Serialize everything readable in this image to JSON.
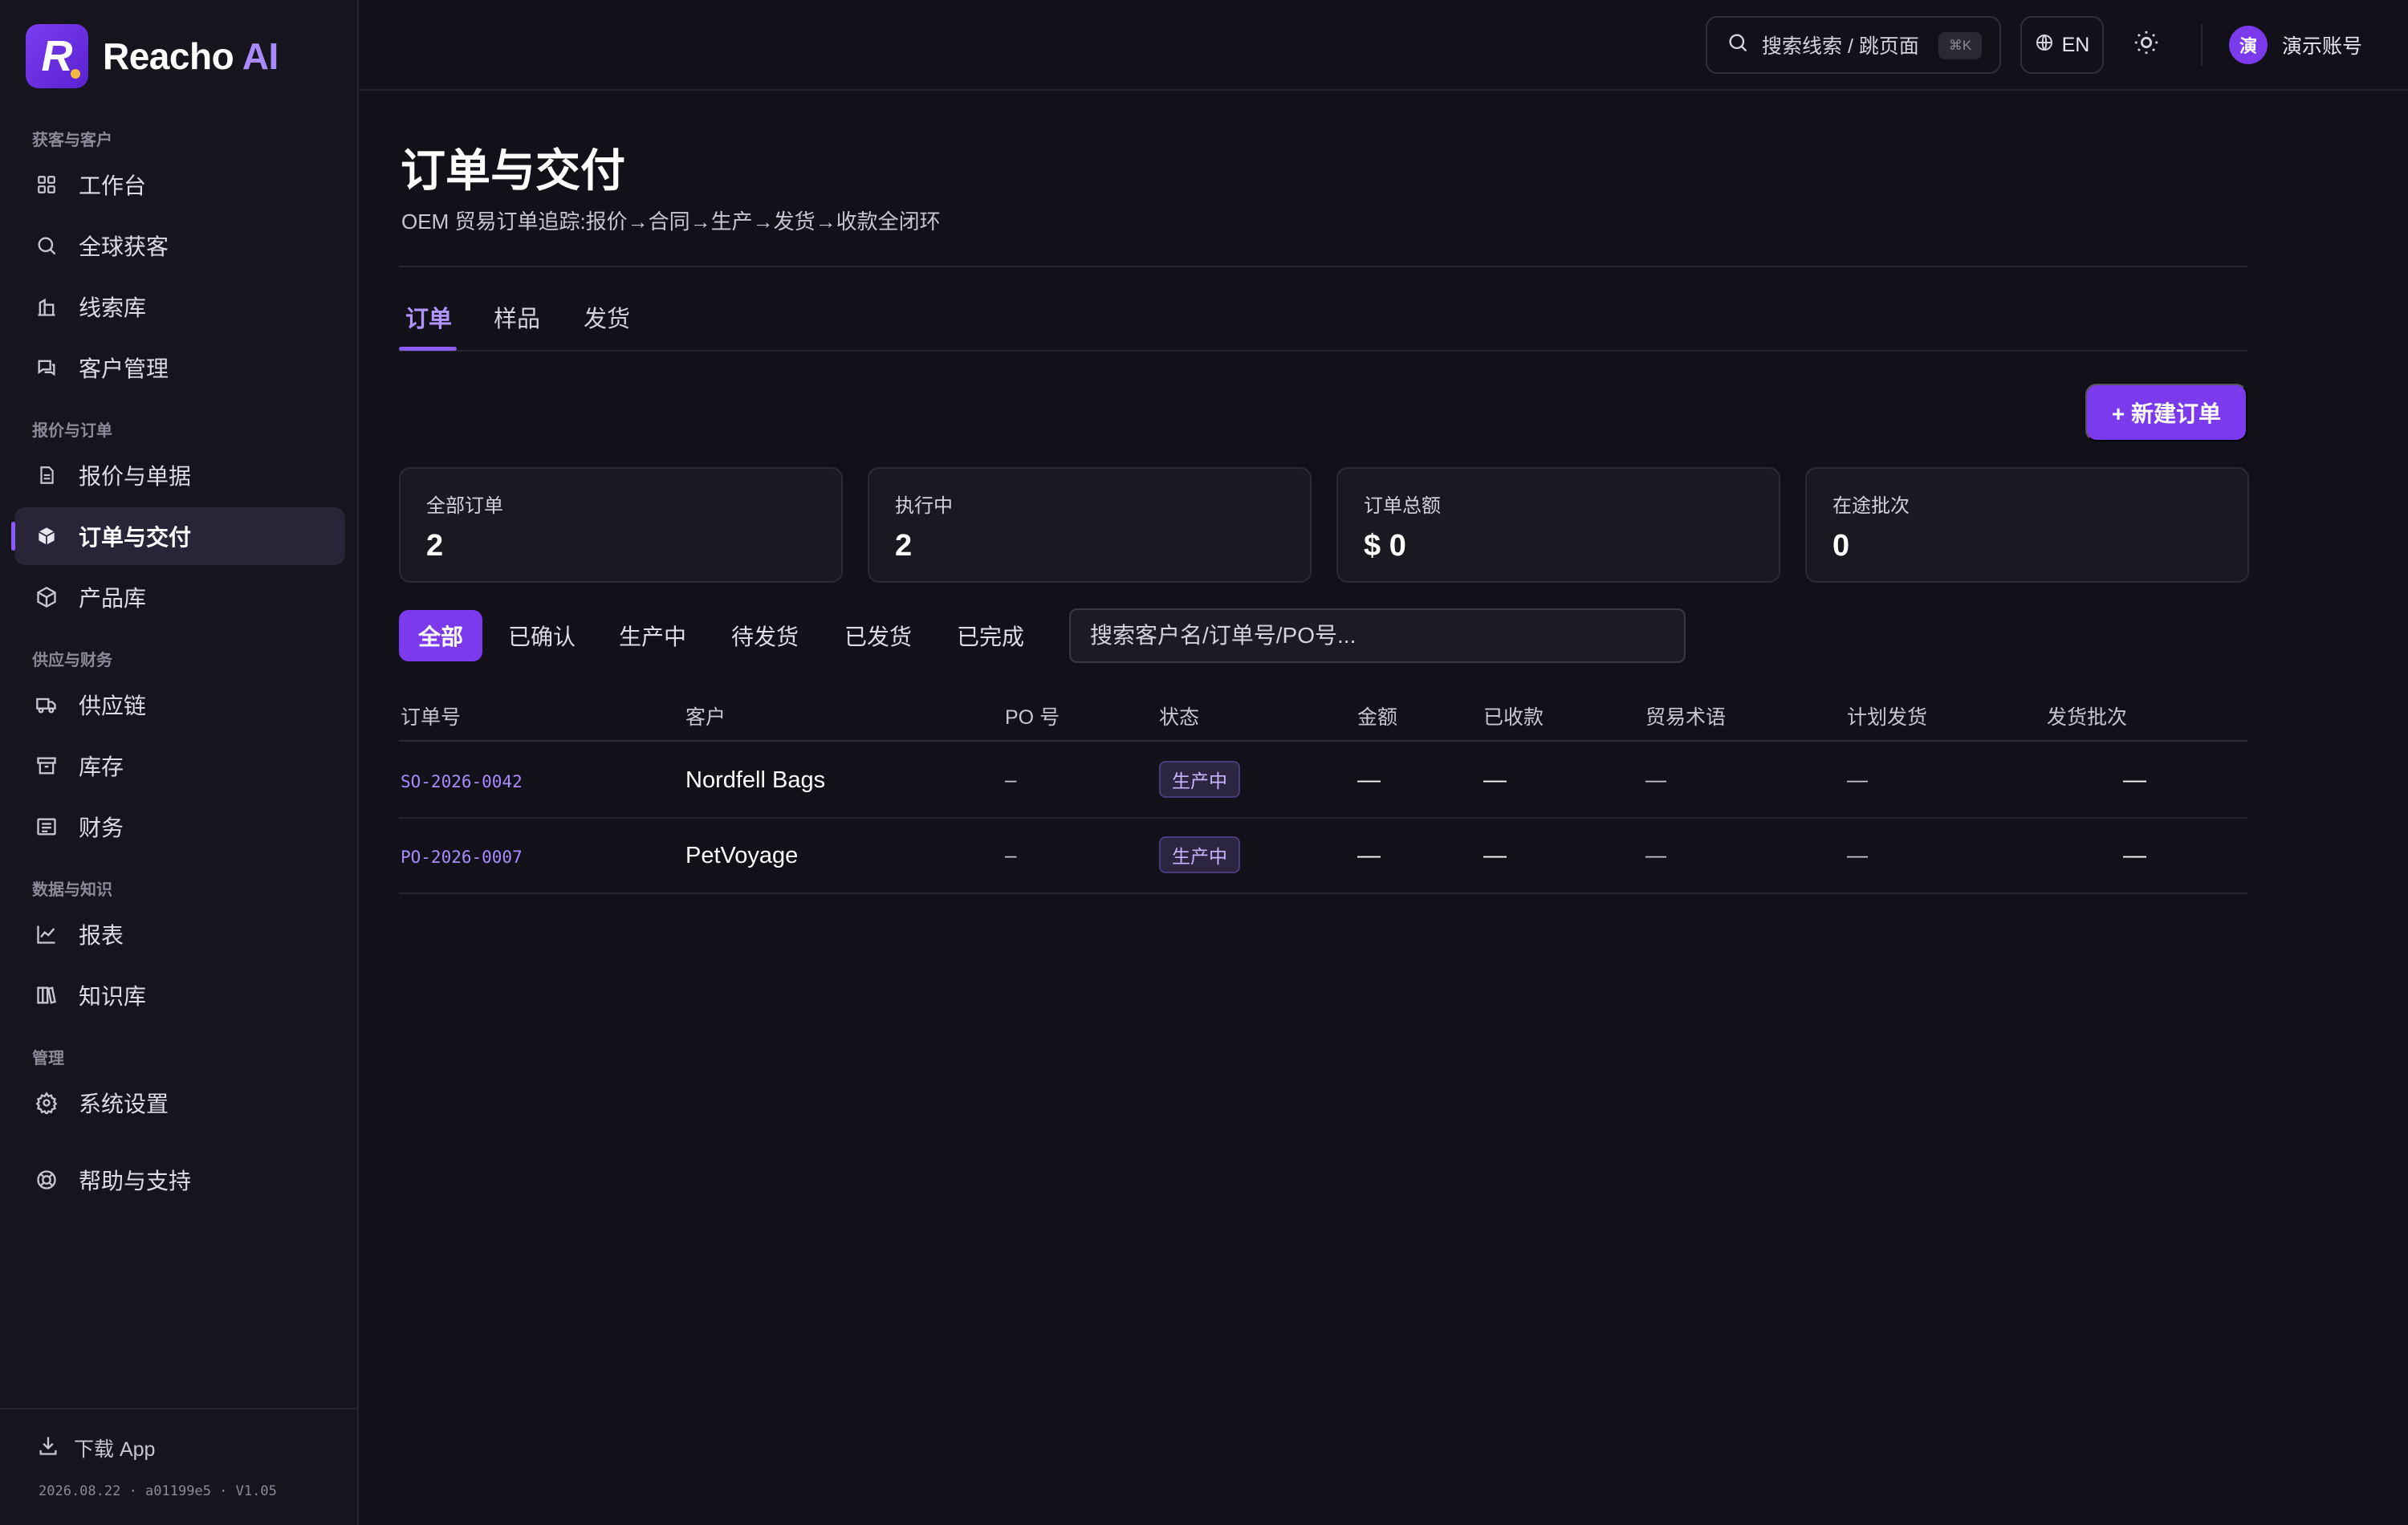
{
  "app": {
    "logo_letter": "R",
    "name_main": "Reacho",
    "name_accent": "AI"
  },
  "sidebar": {
    "sections": [
      "获客与客户",
      "报价与订单",
      "供应与财务",
      "数据与知识",
      "管理"
    ],
    "items": [
      {
        "label": "工作台",
        "icon": "grid-icon"
      },
      {
        "label": "全球获客",
        "icon": "search-icon"
      },
      {
        "label": "线索库",
        "icon": "building-icon"
      },
      {
        "label": "客户管理",
        "icon": "chat-icon"
      },
      {
        "label": "报价与单据",
        "icon": "document-icon"
      },
      {
        "label": "订单与交付",
        "icon": "box-icon",
        "active": true
      },
      {
        "label": "产品库",
        "icon": "cube-icon"
      },
      {
        "label": "供应链",
        "icon": "truck-icon"
      },
      {
        "label": "库存",
        "icon": "archive-icon"
      },
      {
        "label": "财务",
        "icon": "list-icon"
      },
      {
        "label": "报表",
        "icon": "line-chart-icon"
      },
      {
        "label": "知识库",
        "icon": "books-icon"
      },
      {
        "label": "系统设置",
        "icon": "gear-icon"
      },
      {
        "label": "帮助与支持",
        "icon": "lifebuoy-icon"
      }
    ],
    "download_label": "下载 App",
    "version": "2026.08.22 · a01199e5 · V1.05"
  },
  "topbar": {
    "search_label": "搜索线索 / 跳页面",
    "search_shortcut": "⌘K",
    "lang": "EN",
    "avatar_char": "演",
    "account": "演示账号"
  },
  "page": {
    "title": "订单与交付",
    "subtitle": "OEM 贸易订单追踪:报价→合同→生产→发货→收款全闭环",
    "tabs": [
      "订单",
      "样品",
      "发货"
    ],
    "new_button": "+ 新建订单"
  },
  "stats": [
    {
      "label": "全部订单",
      "value": "2"
    },
    {
      "label": "执行中",
      "value": "2"
    },
    {
      "label": "订单总额",
      "value": "$ 0"
    },
    {
      "label": "在途批次",
      "value": "0"
    }
  ],
  "filters": {
    "chips": [
      "全部",
      "已确认",
      "生产中",
      "待发货",
      "已发货",
      "已完成"
    ],
    "search_placeholder": "搜索客户名/订单号/PO号..."
  },
  "table": {
    "columns": [
      "订单号",
      "客户",
      "PO 号",
      "状态",
      "金额",
      "已收款",
      "贸易术语",
      "计划发货",
      "发货批次"
    ],
    "rows": [
      {
        "order_no": "SO-2026-0042",
        "customer": "Nordfell Bags",
        "po": "–",
        "status": "生产中",
        "amount": "—",
        "received": "—",
        "terms": "—",
        "ship_date": "—",
        "batches": "—"
      },
      {
        "order_no": "PO-2026-0007",
        "customer": "PetVoyage",
        "po": "–",
        "status": "生产中",
        "amount": "—",
        "received": "—",
        "terms": "—",
        "ship_date": "—",
        "batches": "—"
      }
    ]
  },
  "colors": {
    "accent": "#7c3aed",
    "background": "#121119",
    "sidebar": "#16151d"
  }
}
